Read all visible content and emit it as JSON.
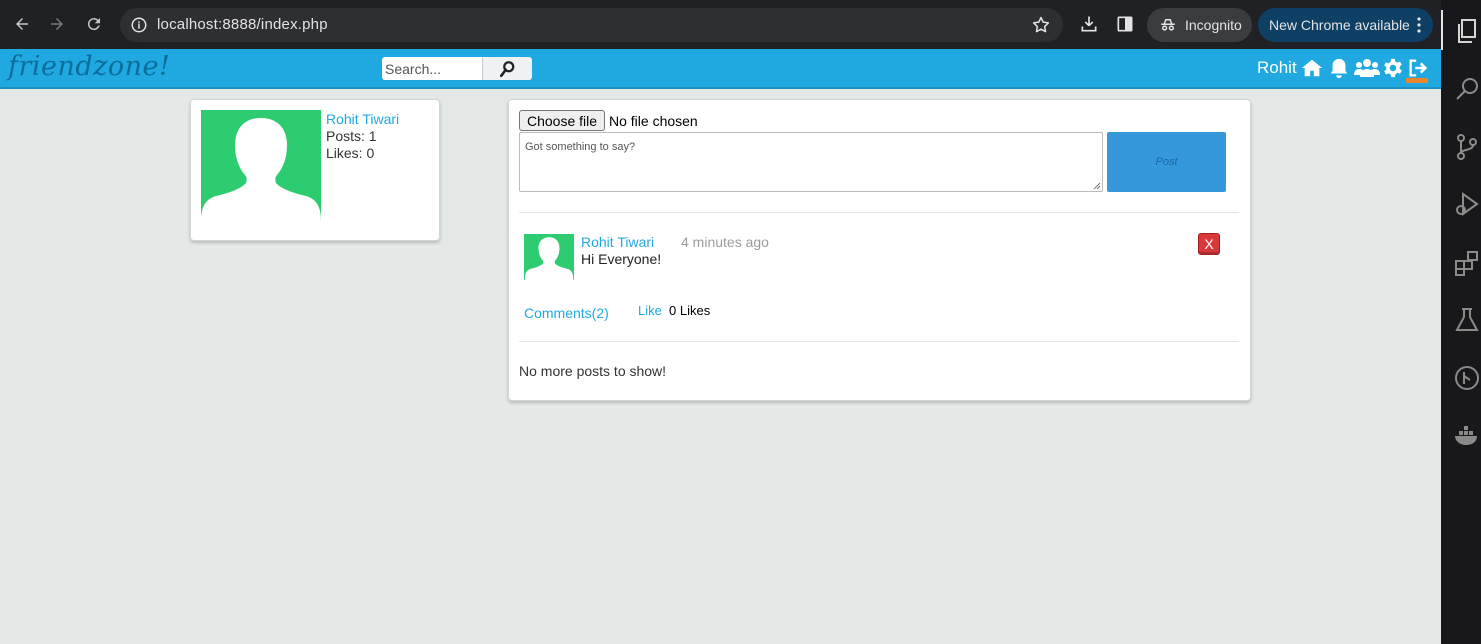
{
  "browser": {
    "url": "localhost:8888/index.php",
    "incognito_label": "Incognito",
    "update_label": "New Chrome available"
  },
  "header": {
    "logo": "friendzone!",
    "search_placeholder": "Search...",
    "user_first_name": "Rohit"
  },
  "profile": {
    "name": "Rohit Tiwari",
    "posts": "Posts: 1",
    "likes": "Likes: 0"
  },
  "composer": {
    "file_button": "Choose file",
    "file_status": "No file chosen",
    "placeholder": "Got something to say?",
    "post_button": "Post"
  },
  "feed": {
    "posts": [
      {
        "author": "Rohit Tiwari",
        "time": "4 minutes ago",
        "body": "Hi Everyone!",
        "delete_label": "X",
        "comments_label": "Comments(2)",
        "like_label": "Like",
        "likes_label": "0 Likes"
      }
    ],
    "end_message": "No more posts to show!"
  },
  "colors": {
    "header_blue": "#20a9e1",
    "avatar_green": "#2ecc71",
    "post_button_blue": "#3498db",
    "delete_red": "#d9383a",
    "notification_orange": "#e8862d"
  },
  "icons": {
    "browser": [
      "back-icon",
      "forward-icon",
      "reload-icon",
      "site-info-icon",
      "bookmark-star-icon",
      "download-icon",
      "side-panel-icon",
      "incognito-icon",
      "more-vert-icon"
    ],
    "header": [
      "search-icon",
      "home-icon",
      "bell-icon",
      "friends-icon",
      "gear-icon",
      "logout-icon"
    ],
    "editor_sidebar": [
      "explorer-icon",
      "search-icon",
      "source-control-icon",
      "run-debug-icon",
      "extensions-icon",
      "testing-icon",
      "git-graph-icon",
      "docker-icon"
    ]
  }
}
